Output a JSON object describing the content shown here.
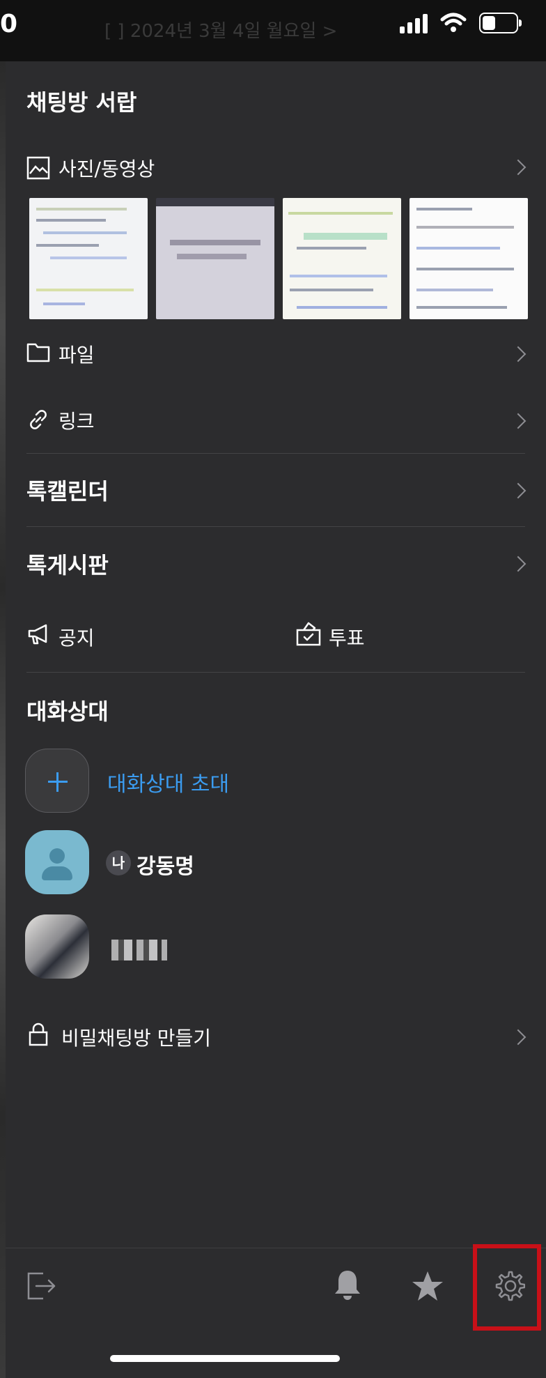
{
  "status_bar": {
    "time": "0",
    "ghost_text": "[ ] 2024년 3월 4일 월요일 >"
  },
  "drawer": {
    "title": "채팅방 서랍",
    "media": {
      "label": "사진/동영상",
      "thumbnails": [
        "document-screenshot",
        "handwritten-note-photo",
        "spreadsheet-screenshot",
        "document-screenshot"
      ]
    },
    "file_label": "파일",
    "link_label": "링크",
    "talk_calendar": "톡캘린더",
    "talk_board": "톡게시판",
    "notice_label": "공지",
    "vote_label": "투표",
    "members_title": "대화상대",
    "invite_label": "대화상대 초대",
    "me_badge": "나",
    "me_name": "강동명",
    "secret_chat_label": "비밀채팅방 만들기"
  },
  "bottom_bar": {
    "icons": [
      "exit-icon",
      "bell-icon",
      "star-icon",
      "gear-icon"
    ]
  },
  "colors": {
    "background": "#2c2c2e",
    "accent_blue": "#3b9cf0",
    "highlight_red": "#c81018",
    "avatar_teal": "#7ab9cf"
  }
}
